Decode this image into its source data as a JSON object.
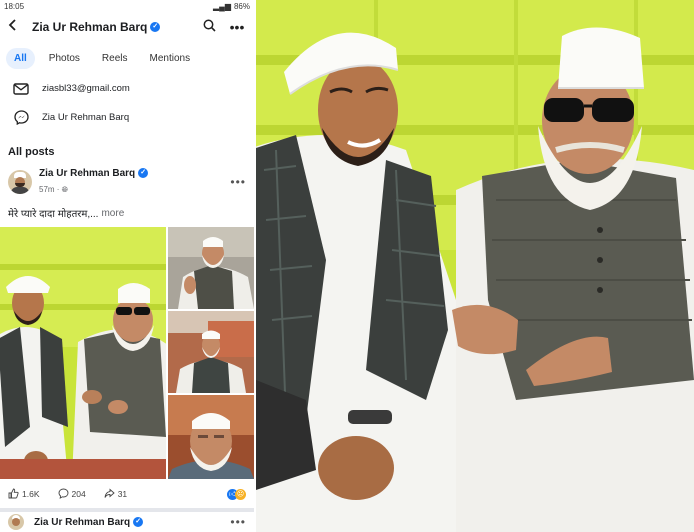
{
  "status_bar": {
    "time": "18:05",
    "battery": "86%"
  },
  "header": {
    "title": "Zia Ur Rehman Barq"
  },
  "tabs": [
    {
      "label": "All"
    },
    {
      "label": "Photos"
    },
    {
      "label": "Reels"
    },
    {
      "label": "Mentions"
    }
  ],
  "contact": {
    "email": "ziasbl33@gmail.com",
    "messenger": "Zia Ur Rehman Barq"
  },
  "section_title": "All posts",
  "post": {
    "author": "Zia Ur Rehman Barq",
    "time": "57m",
    "text": "मेरे प्यारे दादा मोहतरम,...",
    "more": "more",
    "likes": "1.6K",
    "comments": "204",
    "shares": "31"
  },
  "next_post": {
    "author": "Zia Ur Rehman Barq"
  },
  "icons": {
    "back": "arrow-left-icon",
    "search": "search-icon",
    "more": "more-horizontal-icon",
    "email": "mail-icon",
    "messenger": "messenger-icon",
    "globe": "globe-icon",
    "like": "thumb-up-icon",
    "comment": "comment-icon",
    "share": "share-icon"
  },
  "colors": {
    "accent": "#1877f2",
    "tab_active_bg": "#e7f0fd",
    "backdrop": "#c9e43a"
  }
}
